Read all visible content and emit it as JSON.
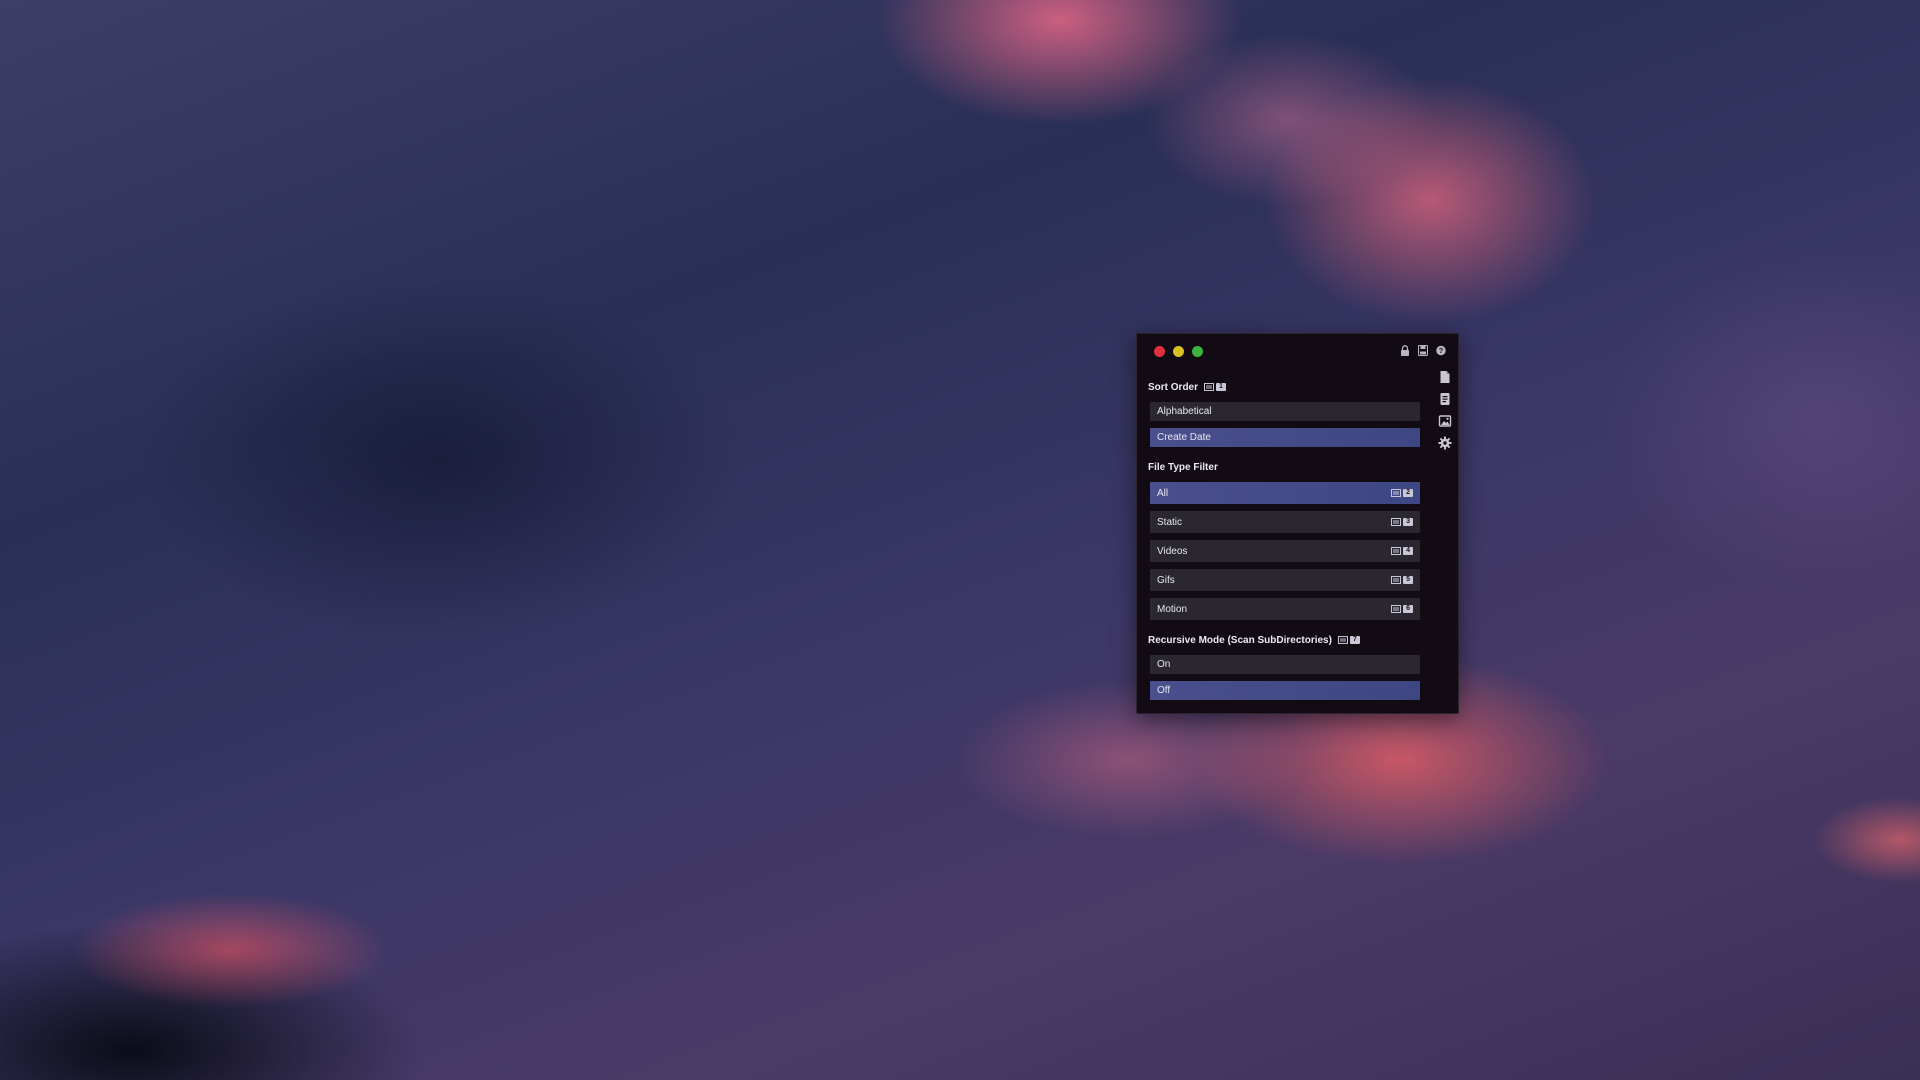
{
  "window": {
    "controls": [
      "close",
      "minimize",
      "maximize"
    ],
    "top_icons": [
      "lock-icon",
      "save-icon",
      "help-icon"
    ],
    "side_icons": [
      "file-icon",
      "document-icon",
      "image-icon",
      "gear-icon"
    ]
  },
  "sort_order": {
    "title": "Sort Order",
    "shortcut": "1",
    "options": [
      {
        "label": "Alphabetical",
        "selected": false
      },
      {
        "label": "Create Date",
        "selected": true
      }
    ]
  },
  "file_type_filter": {
    "title": "File Type Filter",
    "options": [
      {
        "label": "All",
        "shortcut": "2",
        "selected": true
      },
      {
        "label": "Static",
        "shortcut": "3",
        "selected": false
      },
      {
        "label": "Videos",
        "shortcut": "4",
        "selected": false
      },
      {
        "label": "Gifs",
        "shortcut": "5",
        "selected": false
      },
      {
        "label": "Motion",
        "shortcut": "6",
        "selected": false
      }
    ]
  },
  "recursive_mode": {
    "title": "Recursive Mode (Scan SubDirectories)",
    "shortcut": "7",
    "options": [
      {
        "label": "On",
        "selected": false
      },
      {
        "label": "Off",
        "selected": true
      }
    ]
  },
  "colors": {
    "panel_bg": "#120b13",
    "row_bg": "#2a2730",
    "selected_bg": "#4a4f8e",
    "close": "#e0303f",
    "minimize": "#d8c121",
    "maximize": "#3cb23f"
  }
}
